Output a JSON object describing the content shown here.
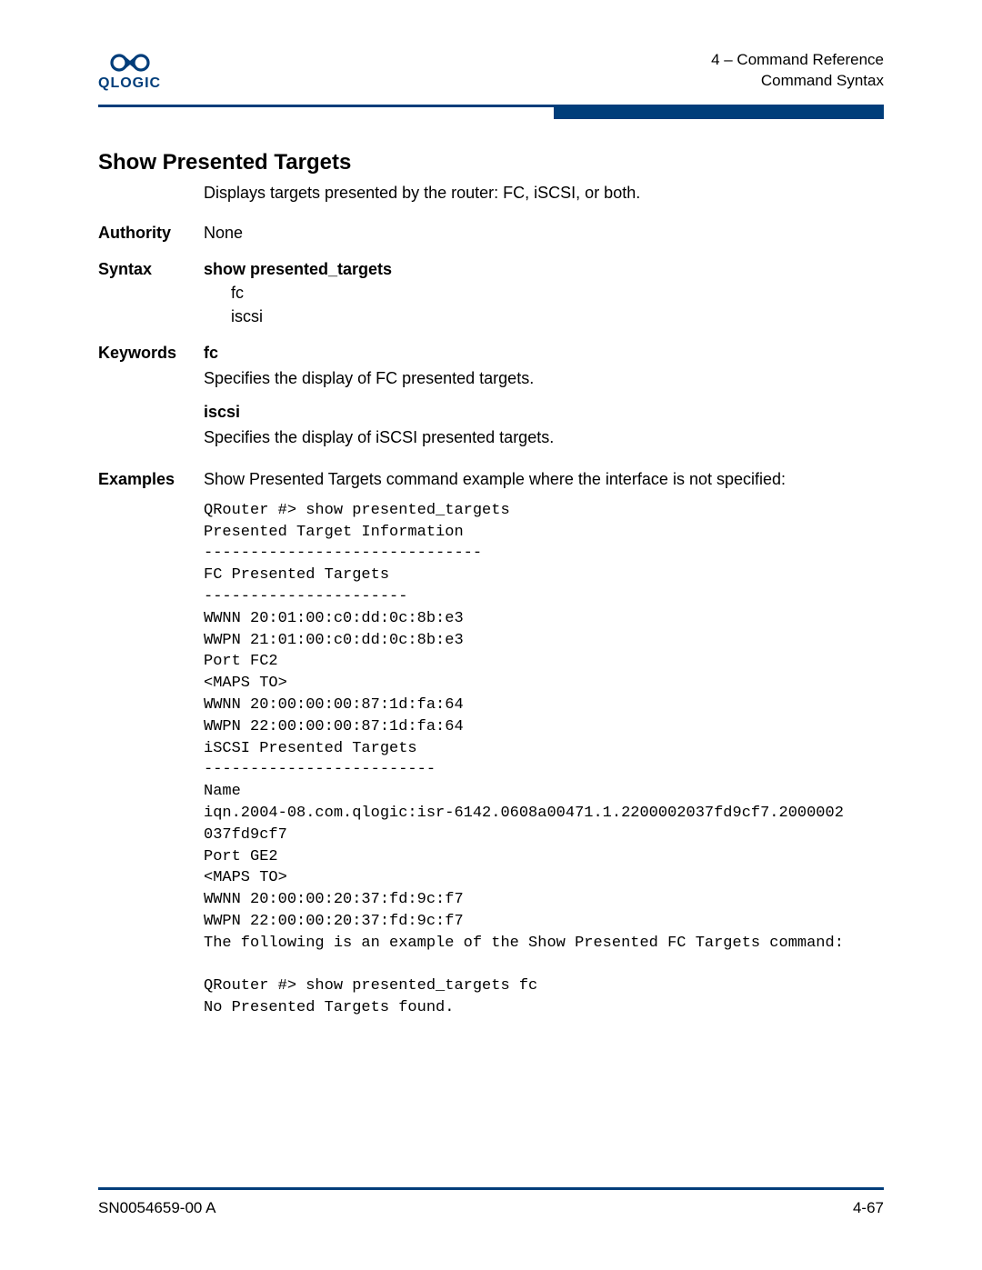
{
  "header": {
    "logo_text": "QLOGIC",
    "line1": "4 – Command Reference",
    "line2": "Command Syntax"
  },
  "title": "Show Presented Targets",
  "intro": "Displays targets presented by the router: FC, iSCSI, or both.",
  "authority": {
    "label": "Authority",
    "value": "None"
  },
  "syntax": {
    "label": "Syntax",
    "command": "show presented_targets",
    "opt1": "fc",
    "opt2": "iscsi"
  },
  "keywords": {
    "label": "Keywords",
    "k1": "fc",
    "k1_desc": "Specifies the display of FC presented targets.",
    "k2": "iscsi",
    "k2_desc": "Specifies the display of iSCSI presented targets."
  },
  "examples": {
    "label": "Examples",
    "intro": "Show Presented Targets command example where the interface is not specified:",
    "block1": "QRouter #> show presented_targets\nPresented Target Information\n------------------------------\nFC Presented Targets\n----------------------\nWWNN 20:01:00:c0:dd:0c:8b:e3\nWWPN 21:01:00:c0:dd:0c:8b:e3\nPort FC2\n<MAPS TO>\nWWNN 20:00:00:00:87:1d:fa:64\nWWPN 22:00:00:00:87:1d:fa:64\niSCSI Presented Targets\n-------------------------\nName\niqn.2004-08.com.qlogic:isr-6142.0608a00471.1.2200002037fd9cf7.2000002\n037fd9cf7\nPort GE2\n<MAPS TO>\nWWNN 20:00:00:20:37:fd:9c:f7\nWWPN 22:00:00:20:37:fd:9c:f7\nThe following is an example of the Show Presented FC Targets command:\n\nQRouter #> show presented_targets fc\nNo Presented Targets found."
  },
  "footer": {
    "left": "SN0054659-00 A",
    "right": "4-67"
  }
}
